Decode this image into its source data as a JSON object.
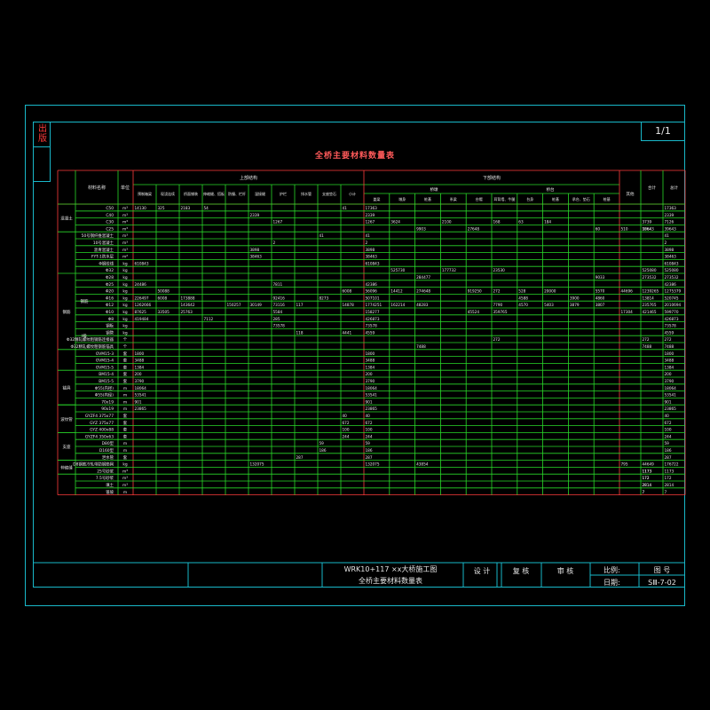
{
  "page": {
    "number": "1/1"
  },
  "side_tab": {
    "label": "出版"
  },
  "table_title": "全桥主要材料数量表",
  "title_block": {
    "project_name": "WRK10+117 ×x大桥施工图",
    "drawing_title": "全桥主要材料数量表",
    "designer_label": "设 计",
    "checker_label": "复 核",
    "reviewer_label": "审 核",
    "scale_label": "比例:",
    "drawing_no_label": "图 号",
    "date_label": "日期:",
    "drawing_no": "SⅢ-7-02"
  },
  "header": {
    "item_col": "材料名称",
    "unit_col": "单位",
    "upper_group": "上部结构",
    "lower_group": "下部结构",
    "upper_cols": [
      "预制箱梁",
      "现浇连续",
      "桥面铺装",
      "伸缩缝、搭板",
      "防撞、栏杆",
      "湿接缝",
      "护栏",
      "排水管",
      "支座垫石",
      "小计"
    ],
    "lower_sub_groups": [
      "桥墩",
      "桥台"
    ],
    "lower_cols": [
      "盖梁",
      "墩身",
      "桩基",
      "系梁",
      "台帽",
      "耳背墙、牛腿",
      "台身",
      "桩基",
      "承台、垫石",
      "桩基"
    ],
    "other_col": "其他",
    "subtotal_col": "合计",
    "total_col": "总计"
  },
  "groups": [
    {
      "label": "混凝土",
      "start": 0,
      "span": 4
    },
    {
      "label": "钢筋",
      "start": 10,
      "span": 11
    },
    {
      "label": "锚具",
      "start": 24,
      "span": 5
    },
    {
      "label": "波纹管",
      "start": 29,
      "span": 4
    },
    {
      "label": "支座",
      "start": 33,
      "span": 4
    },
    {
      "label": "伸缩缝",
      "start": 37,
      "span": 2
    }
  ],
  "sub_groups": [
    {
      "label": "钢筋",
      "start": 10,
      "span": 8
    },
    {
      "label": "Ⅰ级",
      "start": 18,
      "span": 2
    }
  ],
  "rows": [
    {
      "name": "C50",
      "unit": "m³",
      "cells": [
        "14130",
        "325",
        "2183",
        "54",
        "",
        "",
        "",
        "",
        "",
        "41",
        "17363",
        "",
        "",
        "",
        "",
        "",
        "",
        "",
        "",
        "",
        "",
        "",
        "17363"
      ]
    },
    {
      "name": "C40",
      "unit": "m³",
      "cells": [
        "",
        "",
        "",
        "",
        "",
        "2339",
        "",
        "",
        "",
        "",
        "2339",
        "",
        "",
        "",
        "",
        "",
        "",
        "",
        "",
        "",
        "",
        "",
        "2339"
      ]
    },
    {
      "name": "C30",
      "unit": "m³",
      "cells": [
        "",
        "",
        "",
        "",
        "",
        "",
        "1267",
        "",
        "",
        "",
        "1267",
        "3624",
        "",
        "2100",
        "",
        "168",
        "63",
        "184",
        "",
        "",
        "",
        "3739",
        "7126"
      ]
    },
    {
      "name": "C25",
      "unit": "m³",
      "cells": [
        "",
        "",
        "",
        "",
        "",
        "",
        "",
        "",
        "",
        "",
        "",
        "",
        "9903",
        "",
        "27648",
        "",
        "",
        "",
        "",
        "60",
        "510",
        "1864",
        "39643",
        "39643"
      ]
    },
    {
      "name": "50号钢纤维混凝土",
      "unit": "m³",
      "cells": [
        "",
        "",
        "",
        "",
        "",
        "",
        "",
        "",
        "41",
        "",
        "41",
        "",
        "",
        "",
        "",
        "",
        "",
        "",
        "",
        "",
        "",
        "",
        "41"
      ]
    },
    {
      "name": "10号混凝土",
      "unit": "m³",
      "cells": [
        "",
        "",
        "",
        "",
        "",
        "",
        "2",
        "",
        "",
        "",
        "2",
        "",
        "",
        "",
        "",
        "",
        "",
        "",
        "",
        "",
        "",
        "",
        "2"
      ]
    },
    {
      "name": "沥青混凝土",
      "unit": "m³",
      "cells": [
        "",
        "",
        "",
        "",
        "",
        "3898",
        "",
        "",
        "",
        "",
        "3898",
        "",
        "",
        "",
        "",
        "",
        "",
        "",
        "",
        "",
        "",
        "",
        "3898"
      ]
    },
    {
      "name": "FYT-1防水层",
      "unit": "m²",
      "cells": [
        "",
        "",
        "",
        "",
        "",
        "38463",
        "",
        "",
        "",
        "",
        "38463",
        "",
        "",
        "",
        "",
        "",
        "",
        "",
        "",
        "",
        "",
        "",
        "38463"
      ]
    },
    {
      "name": "Φ钢绞线",
      "unit": "kg",
      "cells": [
        "610843",
        "",
        "",
        "",
        "",
        "",
        "",
        "",
        "",
        "",
        "610843",
        "",
        "",
        "",
        "",
        "",
        "",
        "",
        "",
        "",
        "",
        "",
        "610843"
      ]
    },
    {
      "name": "Φ32",
      "unit": "kg",
      "cells": [
        "",
        "",
        "",
        "",
        "",
        "",
        "",
        "",
        "",
        "",
        "",
        "525730",
        "",
        "177732",
        "",
        "23530",
        "",
        "",
        "",
        "",
        "",
        "525080",
        "525080"
      ]
    },
    {
      "name": "Φ28",
      "unit": "kg",
      "cells": [
        "",
        "",
        "",
        "",
        "",
        "",
        "",
        "",
        "",
        "",
        "",
        "",
        "284477",
        "",
        "",
        "",
        "",
        "",
        "",
        "9033",
        "",
        "273532",
        "273532"
      ]
    },
    {
      "name": "Φ25",
      "unit": "kg",
      "cells": [
        "24486",
        "",
        "",
        "",
        "",
        "",
        "7811",
        "",
        "",
        "",
        "42386",
        "",
        "",
        "",
        "",
        "",
        "",
        "",
        "",
        "",
        "",
        "",
        "42386"
      ]
    },
    {
      "name": "Φ20",
      "unit": "kg",
      "cells": [
        "",
        "50088",
        "",
        "",
        "",
        "",
        "",
        "",
        "",
        "6008",
        "56096",
        "14412",
        "274648",
        "",
        "919250",
        "272",
        "528",
        "20000",
        "",
        "5570",
        "44696",
        "1239265",
        "1275379"
      ]
    },
    {
      "name": "Φ16",
      "unit": "kg",
      "cells": [
        "226497",
        "6008",
        "173888",
        "",
        "",
        "",
        "92416",
        "",
        "8273",
        "",
        "507101",
        "",
        "",
        "",
        "",
        "",
        "4588",
        "",
        "3900",
        "4860",
        "",
        "13814",
        "520745"
      ]
    },
    {
      "name": "Φ12",
      "unit": "kg",
      "cells": [
        "1262666",
        "",
        "143642",
        "",
        "150257",
        "30149",
        "73116",
        "117",
        "",
        "14878",
        "1774251",
        "162214",
        "48283",
        "",
        "",
        "7790",
        "4570",
        "5403",
        "3879",
        "3807",
        "",
        "235765",
        "2010694"
      ]
    },
    {
      "name": "Φ10",
      "unit": "kg",
      "cells": [
        "87625",
        "33505",
        "25763",
        "",
        "",
        "",
        "5584",
        "",
        "",
        "",
        "158277",
        "",
        "",
        "",
        "45524",
        "359765",
        "",
        "",
        "",
        "",
        "17304",
        "421465",
        "599770"
      ]
    },
    {
      "name": "Φ8",
      "unit": "kg",
      "cells": [
        "419484",
        "",
        "",
        "7112",
        "",
        "",
        "285",
        "",
        "",
        "",
        "426873",
        "",
        "",
        "",
        "",
        "",
        "",
        "",
        "",
        "",
        "",
        "",
        "426873"
      ]
    },
    {
      "name": "钢板",
      "unit": "kg",
      "cells": [
        "",
        "",
        "",
        "",
        "",
        "",
        "73578",
        "",
        "",
        "",
        "73578",
        "",
        "",
        "",
        "",
        "",
        "",
        "",
        "",
        "",
        "",
        "",
        "73578"
      ]
    },
    {
      "name": "钢管",
      "unit": "kg",
      "cells": [
        "",
        "",
        "",
        "",
        "",
        "",
        "",
        "118",
        "",
        "4441",
        "4559",
        "",
        "",
        "",
        "",
        "",
        "",
        "",
        "",
        "",
        "",
        "",
        "4559"
      ]
    },
    {
      "name": "Φ32精轧螺纹粗钢筋连接器",
      "unit": "个",
      "cells": [
        "",
        "",
        "",
        "",
        "",
        "",
        "",
        "",
        "",
        "",
        "",
        "",
        "",
        "",
        "",
        "272",
        "",
        "",
        "",
        "",
        "",
        "272",
        "272"
      ]
    },
    {
      "name": "Φ32精轧螺纹粗钢筋锚具",
      "unit": "个",
      "cells": [
        "",
        "",
        "",
        "",
        "",
        "",
        "",
        "",
        "",
        "",
        "",
        "",
        "7488",
        "",
        "",
        "",
        "",
        "",
        "",
        "",
        "",
        "7488",
        "7488"
      ]
    },
    {
      "name": "OVM15-3",
      "unit": "套",
      "cells": [
        "1800",
        "",
        "",
        "",
        "",
        "",
        "",
        "",
        "",
        "",
        "1800",
        "",
        "",
        "",
        "",
        "",
        "",
        "",
        "",
        "",
        "",
        "",
        "1800"
      ]
    },
    {
      "name": "OVM15-4",
      "unit": "套",
      "cells": [
        "3488",
        "",
        "",
        "",
        "",
        "",
        "",
        "",
        "",
        "",
        "3488",
        "",
        "",
        "",
        "",
        "",
        "",
        "",
        "",
        "",
        "",
        "",
        "3488"
      ]
    },
    {
      "name": "OVM15-5",
      "unit": "套",
      "cells": [
        "1384",
        "",
        "",
        "",
        "",
        "",
        "",
        "",
        "",
        "",
        "1384",
        "",
        "",
        "",
        "",
        "",
        "",
        "",
        "",
        "",
        "",
        "",
        "1384"
      ]
    },
    {
      "name": "BM15-4",
      "unit": "套",
      "cells": [
        "200",
        "",
        "",
        "",
        "",
        "",
        "",
        "",
        "",
        "",
        "200",
        "",
        "",
        "",
        "",
        "",
        "",
        "",
        "",
        "",
        "",
        "",
        "200"
      ]
    },
    {
      "name": "BM15-5",
      "unit": "套",
      "cells": [
        "3790",
        "",
        "",
        "",
        "",
        "",
        "",
        "",
        "",
        "",
        "3790",
        "",
        "",
        "",
        "",
        "",
        "",
        "",
        "",
        "",
        "",
        "",
        "3790"
      ]
    },
    {
      "name": "Φ55(内径)",
      "unit": "m",
      "cells": [
        "18064",
        "",
        "",
        "",
        "",
        "",
        "",
        "",
        "",
        "",
        "18064",
        "",
        "",
        "",
        "",
        "",
        "",
        "",
        "",
        "",
        "",
        "",
        "18064"
      ]
    },
    {
      "name": "Φ55(内径)",
      "unit": "m",
      "cells": [
        "53541",
        "",
        "",
        "",
        "",
        "",
        "",
        "",
        "",
        "",
        "53541",
        "",
        "",
        "",
        "",
        "",
        "",
        "",
        "",
        "",
        "",
        "",
        "53541"
      ]
    },
    {
      "name": "70x19",
      "unit": "m",
      "cells": [
        "901",
        "",
        "",
        "",
        "",
        "",
        "",
        "",
        "",
        "",
        "901",
        "",
        "",
        "",
        "",
        "",
        "",
        "",
        "",
        "",
        "",
        "",
        "901"
      ]
    },
    {
      "name": "90x19",
      "unit": "m",
      "cells": [
        "23865",
        "",
        "",
        "",
        "",
        "",
        "",
        "",
        "",
        "",
        "23865",
        "",
        "",
        "",
        "",
        "",
        "",
        "",
        "",
        "",
        "",
        "",
        "23865"
      ]
    },
    {
      "name": "GYZF4 375x77",
      "unit": "套",
      "cells": [
        "",
        "",
        "",
        "",
        "",
        "",
        "",
        "",
        "",
        "40",
        "40",
        "",
        "",
        "",
        "",
        "",
        "",
        "",
        "",
        "",
        "",
        "",
        "40"
      ]
    },
    {
      "name": "GYZ 375x77",
      "unit": "套",
      "cells": [
        "",
        "",
        "",
        "",
        "",
        "",
        "",
        "",
        "",
        "672",
        "672",
        "",
        "",
        "",
        "",
        "",
        "",
        "",
        "",
        "",
        "",
        "",
        "672"
      ]
    },
    {
      "name": "GYZ 400x88",
      "unit": "套",
      "cells": [
        "",
        "",
        "",
        "",
        "",
        "",
        "",
        "",
        "",
        "100",
        "100",
        "",
        "",
        "",
        "",
        "",
        "",
        "",
        "",
        "",
        "",
        "",
        "100"
      ]
    },
    {
      "name": "GYZF4 350x63",
      "unit": "套",
      "cells": [
        "",
        "",
        "",
        "",
        "",
        "",
        "",
        "",
        "",
        "244",
        "244",
        "",
        "",
        "",
        "",
        "",
        "",
        "",
        "",
        "",
        "",
        "",
        "244"
      ]
    },
    {
      "name": "D80型",
      "unit": "m",
      "cells": [
        "",
        "",
        "",
        "",
        "",
        "",
        "",
        "",
        "59",
        "",
        "59",
        "",
        "",
        "",
        "",
        "",
        "",
        "",
        "",
        "",
        "",
        "",
        "59"
      ]
    },
    {
      "name": "D160型",
      "unit": "m",
      "cells": [
        "",
        "",
        "",
        "",
        "",
        "",
        "",
        "",
        "186",
        "",
        "186",
        "",
        "",
        "",
        "",
        "",
        "",
        "",
        "",
        "",
        "",
        "",
        "186"
      ]
    },
    {
      "name": "泄水管",
      "unit": "套",
      "cells": [
        "",
        "",
        "",
        "",
        "",
        "",
        "",
        "287",
        "",
        "",
        "287",
        "",
        "",
        "",
        "",
        "",
        "",
        "",
        "",
        "",
        "",
        "",
        "287"
      ]
    },
    {
      "name": "D8钢筋冷轧带肋钢筋网",
      "unit": "kg",
      "cells": [
        "",
        "",
        "",
        "",
        "",
        "132075",
        "",
        "",
        "",
        "",
        "132075",
        "",
        "43854",
        "",
        "",
        "",
        "",
        "",
        "",
        "",
        "795",
        "44649",
        "176722"
      ]
    },
    {
      "name": "25号砂浆",
      "unit": "m³",
      "cells": [
        "",
        "",
        "",
        "",
        "",
        "",
        "",
        "",
        "",
        "",
        "",
        "",
        "",
        "",
        "",
        "",
        "",
        "",
        "",
        "",
        "",
        "1173",
        "1173",
        "1173"
      ]
    },
    {
      "name": "7.5号砂浆",
      "unit": "m³",
      "cells": [
        "",
        "",
        "",
        "",
        "",
        "",
        "",
        "",
        "",
        "",
        "",
        "",
        "",
        "",
        "",
        "",
        "",
        "",
        "",
        "",
        "",
        "172",
        "172",
        "172"
      ]
    },
    {
      "name": "填土",
      "unit": "m³",
      "cells": [
        "",
        "",
        "",
        "",
        "",
        "",
        "",
        "",
        "",
        "",
        "",
        "",
        "",
        "",
        "",
        "",
        "",
        "",
        "",
        "",
        "",
        "2814",
        "2814",
        "2814"
      ]
    },
    {
      "name": "锥坡",
      "unit": "m",
      "cells": [
        "",
        "",
        "",
        "",
        "",
        "",
        "",
        "",
        "",
        "",
        "",
        "",
        "",
        "",
        "",
        "",
        "",
        "",
        "",
        "",
        "",
        "7",
        "7",
        "7"
      ]
    }
  ]
}
